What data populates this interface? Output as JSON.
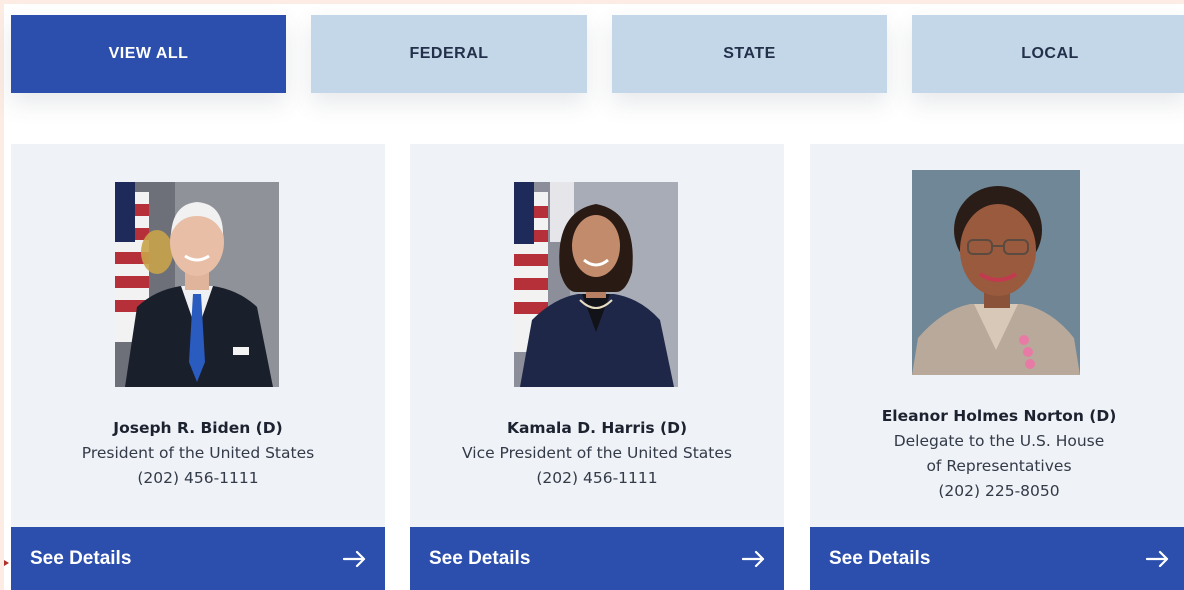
{
  "tabs": [
    {
      "label": "VIEW ALL",
      "active": true
    },
    {
      "label": "FEDERAL",
      "active": false
    },
    {
      "label": "STATE",
      "active": false
    },
    {
      "label": "LOCAL",
      "active": false
    }
  ],
  "cards": [
    {
      "name": "Joseph R. Biden (D)",
      "role_lines": [
        "President of the United States"
      ],
      "phone": "(202) 456-1111",
      "action_label": "See Details",
      "action_icon": "arrow-right-icon"
    },
    {
      "name": "Kamala D. Harris (D)",
      "role_lines": [
        "Vice President of the United States"
      ],
      "phone": "(202) 456-1111",
      "action_label": "See Details",
      "action_icon": "arrow-right-icon"
    },
    {
      "name": "Eleanor Holmes Norton (D)",
      "role_lines": [
        "Delegate to the U.S. House",
        "of Representatives"
      ],
      "phone": "(202) 225-8050",
      "action_label": "See Details",
      "action_icon": "arrow-right-icon"
    }
  ],
  "colors": {
    "primary": "#2c4fae",
    "tab_inactive": "#c4d7e8",
    "card_bg": "#eff2f6"
  }
}
